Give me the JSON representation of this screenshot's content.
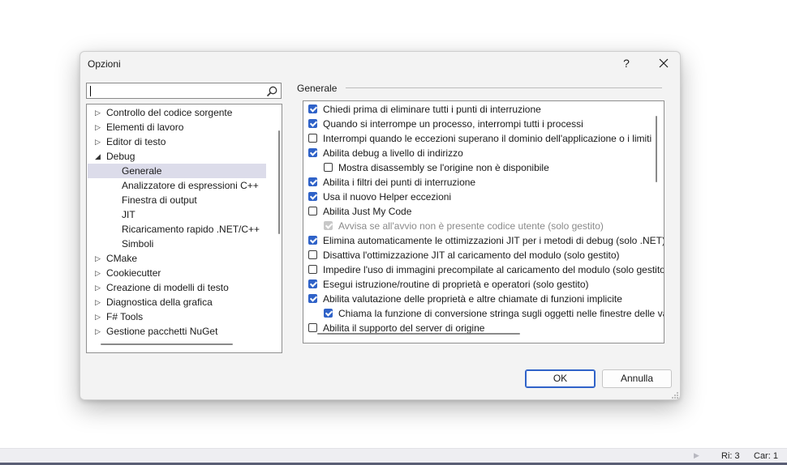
{
  "dialog": {
    "title": "Opzioni",
    "help_label": "?",
    "search": {
      "value": "",
      "placeholder": ""
    },
    "tree": [
      {
        "label": "Controllo del codice sorgente",
        "expander": "collapsed",
        "level": 0
      },
      {
        "label": "Elementi di lavoro",
        "expander": "collapsed",
        "level": 0
      },
      {
        "label": "Editor di testo",
        "expander": "collapsed",
        "level": 0
      },
      {
        "label": "Debug",
        "expander": "expanded",
        "level": 0
      },
      {
        "label": "Generale",
        "expander": "none",
        "level": 1,
        "selected": true
      },
      {
        "label": "Analizzatore di espressioni C++",
        "expander": "none",
        "level": 1
      },
      {
        "label": "Finestra di output",
        "expander": "none",
        "level": 1
      },
      {
        "label": "JIT",
        "expander": "none",
        "level": 1
      },
      {
        "label": "Ricaricamento rapido .NET/C++",
        "expander": "none",
        "level": 1
      },
      {
        "label": "Simboli",
        "expander": "none",
        "level": 1
      },
      {
        "label": "CMake",
        "expander": "collapsed",
        "level": 0
      },
      {
        "label": "Cookiecutter",
        "expander": "collapsed",
        "level": 0
      },
      {
        "label": "Creazione di modelli di testo",
        "expander": "collapsed",
        "level": 0
      },
      {
        "label": "Diagnostica della grafica",
        "expander": "collapsed",
        "level": 0
      },
      {
        "label": "F# Tools",
        "expander": "collapsed",
        "level": 0
      },
      {
        "label": "Gestione pacchetti NuGet",
        "expander": "collapsed",
        "level": 0
      }
    ],
    "group_label": "Generale",
    "options": [
      {
        "label": "Chiedi prima di eliminare tutti i punti di interruzione",
        "checked": true,
        "indent": 0
      },
      {
        "label": "Quando si interrompe un processo, interrompi tutti i processi",
        "checked": true,
        "indent": 0
      },
      {
        "label": "Interrompi quando le eccezioni superano il dominio dell'applicazione o i limiti",
        "checked": false,
        "indent": 0
      },
      {
        "label": "Abilita debug a livello di indirizzo",
        "checked": true,
        "indent": 0
      },
      {
        "label": "Mostra disassembly se l'origine non è disponibile",
        "checked": false,
        "indent": 1
      },
      {
        "label": "Abilita i filtri dei punti di interruzione",
        "checked": true,
        "indent": 0
      },
      {
        "label": "Usa il nuovo Helper eccezioni",
        "checked": true,
        "indent": 0
      },
      {
        "label": "Abilita Just My Code",
        "checked": false,
        "indent": 0
      },
      {
        "label": "Avvisa se all'avvio non è presente codice utente (solo gestito)",
        "checked": true,
        "indent": 1,
        "disabled": true
      },
      {
        "label": "Elimina automaticamente le ottimizzazioni JIT per i metodi di debug (solo .NET)",
        "checked": true,
        "indent": 0
      },
      {
        "label": "Disattiva l'ottimizzazione JIT al caricamento del modulo (solo gestito)",
        "checked": false,
        "indent": 0
      },
      {
        "label": "Impedire l'uso di immagini precompilate al caricamento del modulo (solo gestito)",
        "checked": false,
        "indent": 0
      },
      {
        "label": "Esegui istruzione/routine di proprietà e operatori (solo gestito)",
        "checked": true,
        "indent": 0
      },
      {
        "label": "Abilita valutazione delle proprietà e altre chiamate di funzioni implicite",
        "checked": true,
        "indent": 0
      },
      {
        "label": "Chiama la funzione di conversione stringa sugli oggetti nelle finestre delle variabili",
        "checked": true,
        "indent": 1
      },
      {
        "label": "Abilita il supporto del server di origine",
        "checked": false,
        "indent": 0
      }
    ],
    "ok_label": "OK",
    "cancel_label": "Annulla"
  },
  "statusbar": {
    "line": "Ri: 3",
    "column": "Car: 1"
  },
  "colors": {
    "accent": "#2f62c8",
    "selection": "#dcdcea"
  }
}
